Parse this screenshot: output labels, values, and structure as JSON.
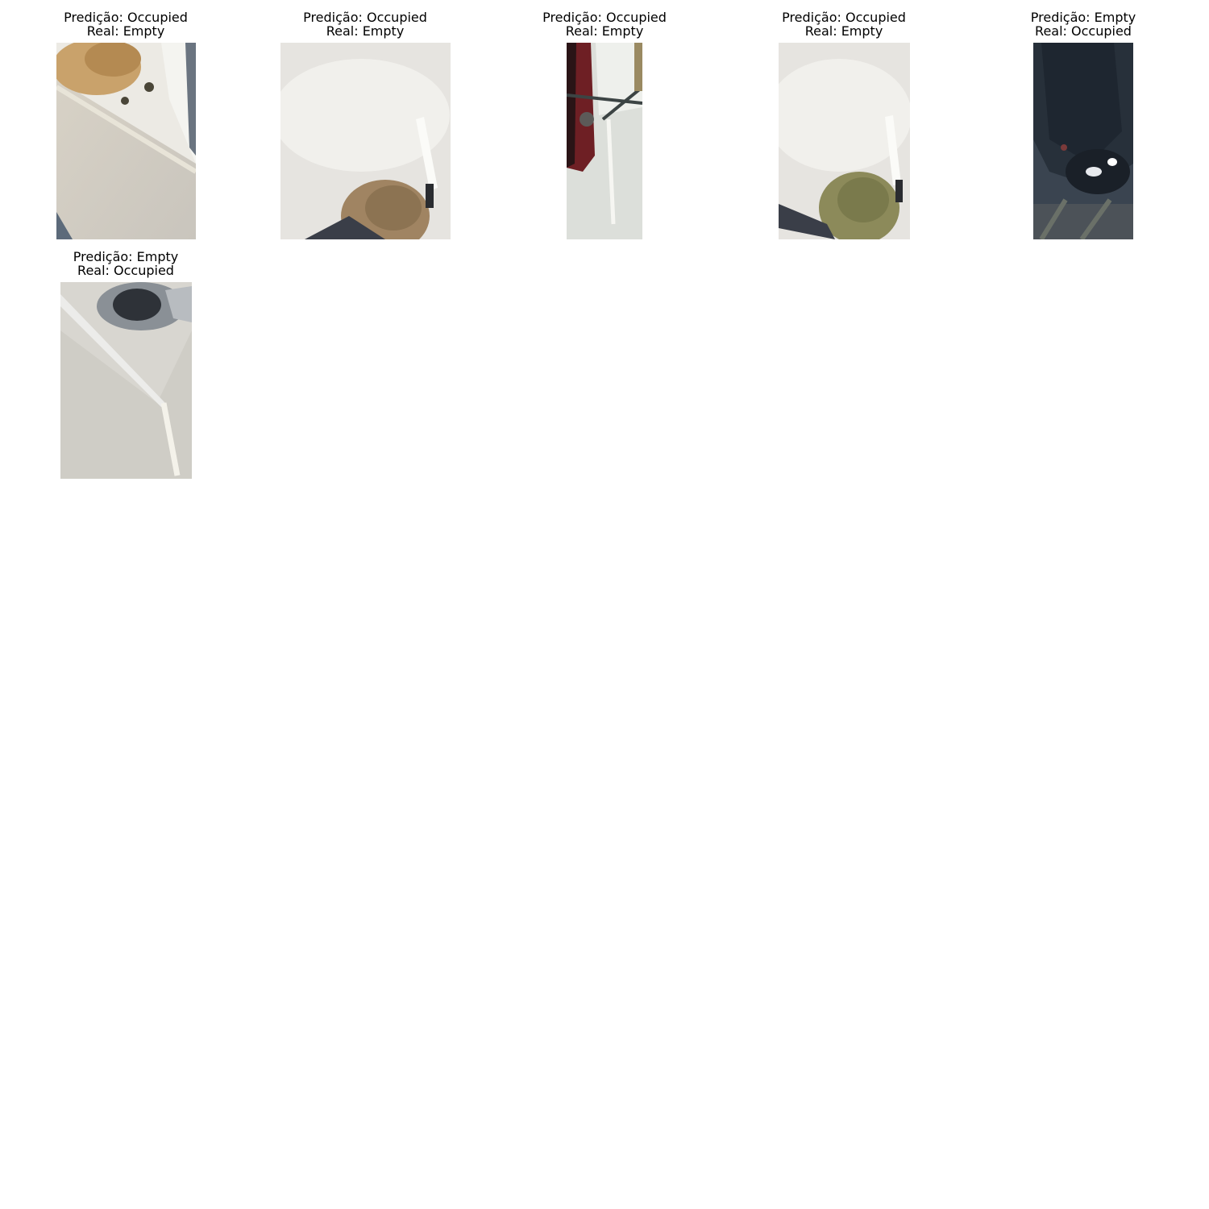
{
  "panels": [
    {
      "prediction": "Predição: Occupied",
      "real": "Real: Empty",
      "scene": "plant-edge"
    },
    {
      "prediction": "Predição: Occupied",
      "real": "Real: Empty",
      "scene": "bush-line"
    },
    {
      "prediction": "Predição: Occupied",
      "real": "Real: Empty",
      "scene": "red-car-edge"
    },
    {
      "prediction": "Predição: Occupied",
      "real": "Real: Empty",
      "scene": "bush-line"
    },
    {
      "prediction": "Predição: Empty",
      "real": "Real: Occupied",
      "scene": "dark-car"
    },
    {
      "prediction": "Predição: Empty",
      "real": "Real: Occupied",
      "scene": "curb-car"
    }
  ]
}
